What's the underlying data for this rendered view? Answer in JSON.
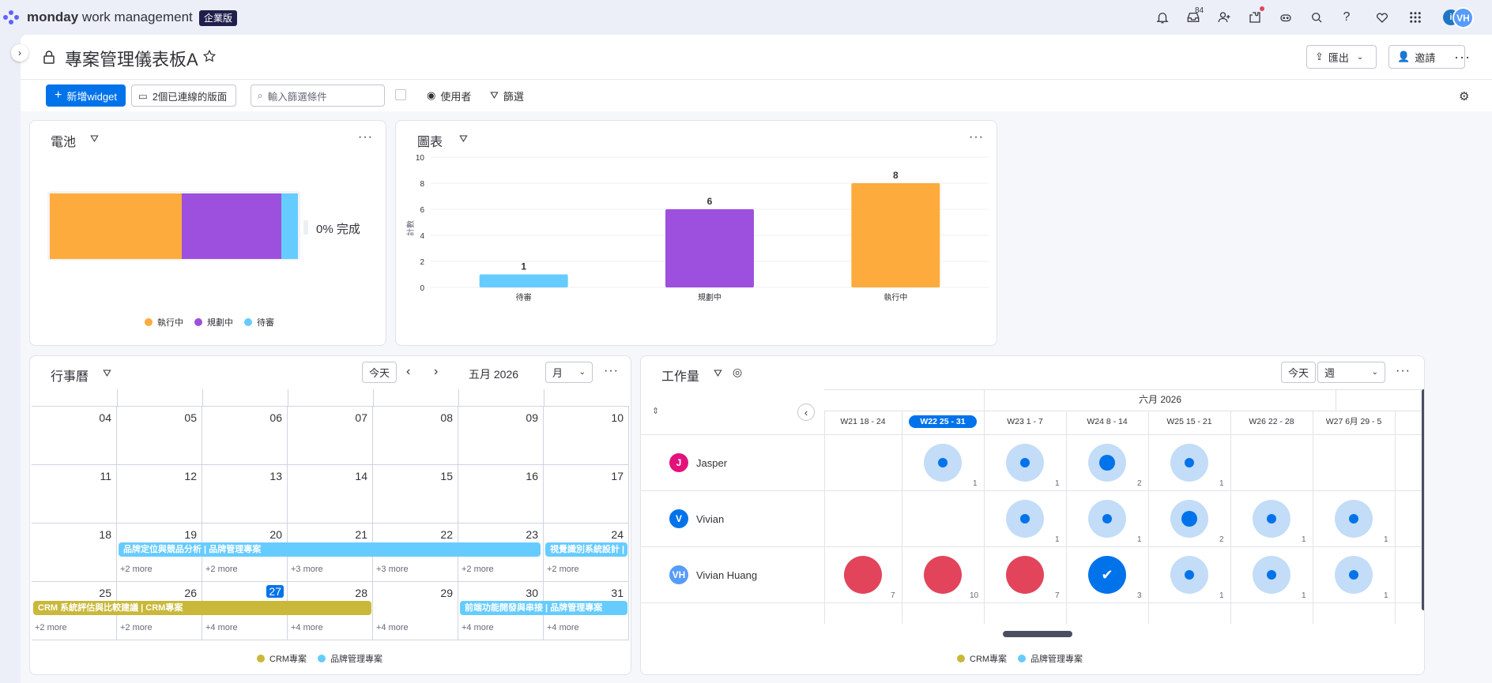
{
  "app": {
    "brand_bold": "monday",
    "brand_rest": " work management",
    "plan_badge": "企業版",
    "notif_count": "84",
    "user_initials": "VH"
  },
  "board": {
    "title": "專案管理儀表板A",
    "export_label": "匯出",
    "invite_label": "邀請"
  },
  "toolbar": {
    "add_widget_label": "新增widget",
    "connected_boards_label": "2個已連線的版面",
    "filter_placeholder": "輸入篩選條件",
    "users_label": "使用者",
    "filter_label": "篩選"
  },
  "battery": {
    "title": "電池",
    "done_label": "0% 完成",
    "segments": [
      {
        "label": "執行中",
        "color": "#fdab3d",
        "value": 8
      },
      {
        "label": "規劃中",
        "color": "#9d50dd",
        "value": 6
      },
      {
        "label": "待審",
        "color": "#66ccff",
        "value": 1
      }
    ]
  },
  "chart_data": {
    "type": "bar",
    "title": "圖表",
    "ylabel": "計數",
    "categories": [
      "待審",
      "規劃中",
      "執行中"
    ],
    "values": [
      1,
      6,
      8
    ],
    "colors": [
      "#66ccff",
      "#9d50dd",
      "#fdab3d"
    ],
    "ylim": [
      0,
      10
    ],
    "yticks": [
      "0",
      "2",
      "4",
      "6",
      "8",
      "10"
    ],
    "grid": true
  },
  "calendar": {
    "title": "行事曆",
    "today_label": "今天",
    "month_label": "五月 2026",
    "view_label": "月",
    "weeks": [
      [
        "04",
        "05",
        "06",
        "07",
        "08",
        "09",
        "10"
      ],
      [
        "11",
        "12",
        "13",
        "14",
        "15",
        "16",
        "17"
      ],
      [
        "18",
        "19",
        "20",
        "21",
        "22",
        "23",
        "24"
      ],
      [
        "25",
        "26",
        "27",
        "28",
        "29",
        "30",
        "31"
      ]
    ],
    "today": "27",
    "week3_more": [
      "+2 more",
      "+2 more",
      "+3 more",
      "+3 more",
      "+2 more",
      "+2 more"
    ],
    "week4_more": [
      "+2 more",
      "+2 more",
      "+4 more",
      "+4 more",
      "+4 more",
      "+4 more"
    ],
    "events": [
      {
        "label": "品牌定位與競品分析 | 品牌管理專案",
        "color": "#66ccff"
      },
      {
        "label": "視覺識別系統設計 |",
        "color": "#66ccff"
      },
      {
        "label": "CRM 系統評估與比較建議 | CRM專案",
        "color": "#c9b839"
      },
      {
        "label": "前端功能開發與串接 | 品牌管理專案",
        "color": "#66ccff"
      }
    ],
    "legend": [
      {
        "label": "CRM專案",
        "color": "#c9b839"
      },
      {
        "label": "品牌管理專案",
        "color": "#66ccff"
      }
    ]
  },
  "workload": {
    "title": "工作量",
    "today_label": "今天",
    "view_label": "週",
    "month_label": "六月 2026",
    "weeks": [
      "W21 18 - 24",
      "W22 25 - 31",
      "W23 1 - 7",
      "W24 8 - 14",
      "W25 15 - 21",
      "W26 22 - 28",
      "W27 6月 29 - 5"
    ],
    "current_week": 1,
    "people": [
      {
        "name": "Jasper",
        "initial": "J",
        "color": "#e2127a",
        "cells": [
          null,
          {
            "count": "1",
            "level": 1
          },
          {
            "count": "1",
            "level": 1
          },
          {
            "count": "2",
            "level": 2
          },
          {
            "count": "1",
            "level": 1
          },
          null,
          null
        ]
      },
      {
        "name": "Vivian",
        "initial": "V",
        "color": "#0073ea",
        "cells": [
          null,
          null,
          {
            "count": "1",
            "level": 1
          },
          {
            "count": "1",
            "level": 1
          },
          {
            "count": "2",
            "level": 2
          },
          {
            "count": "1",
            "level": 1
          },
          {
            "count": "1",
            "level": 1
          }
        ]
      },
      {
        "name": "Vivian Huang",
        "initial": "VH",
        "color": "#579bfc",
        "cells": [
          {
            "count": "7",
            "level": "over"
          },
          {
            "count": "10",
            "level": "over"
          },
          {
            "count": "7",
            "level": "over"
          },
          {
            "count": "3",
            "level": "full"
          },
          {
            "count": "1",
            "level": 1
          },
          {
            "count": "1",
            "level": 1
          },
          {
            "count": "1",
            "level": 1
          }
        ]
      }
    ],
    "legend": [
      {
        "label": "CRM專案",
        "color": "#c9b839"
      },
      {
        "label": "品牌管理專案",
        "color": "#66ccff"
      }
    ]
  }
}
